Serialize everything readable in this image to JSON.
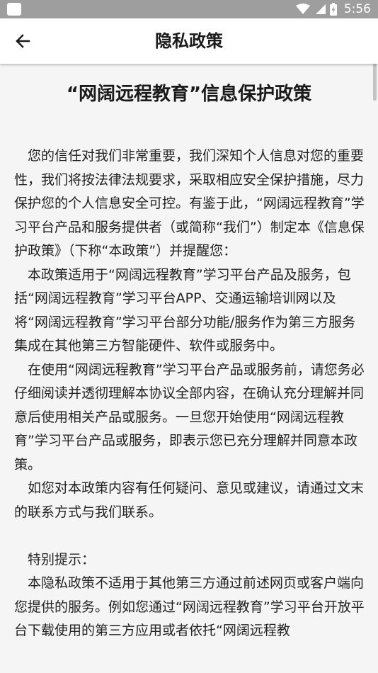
{
  "status_bar": {
    "time": "5:56"
  },
  "app_bar": {
    "title": "隐私政策"
  },
  "document": {
    "title": "“网阔远程教育”信息保护政策",
    "paragraphs": [
      "您的信任对我们非常重要，我们深知个人信息对您的重要性，我们将按法律法规要求，采取相应安全保护措施，尽力保护您的个人信息安全可控。有鉴于此，“网阔远程教育”学习平台产品和服务提供者（或简称“我们”）制定本《信息保护政策》（下称“本政策”）并提醒您：",
      "本政策适用于“网阔远程教育”学习平台产品及服务，包括“网阔远程教育”学习平台APP、交通运输培训网以及将“网阔远程教育”学习平台部分功能/服务作为第三方服务集成在其他第三方智能硬件、软件或服务中。",
      "在使用“网阔远程教育”学习平台产品或服务前，请您务必仔细阅读并透彻理解本协议全部内容，在确认充分理解并同意后使用相关产品或服务。一旦您开始使用“网阔远程教育”学习平台产品或服务，即表示您已充分理解并同意本政策。",
      "如您对本政策内容有任何疑问、意见或建议，请通过文末的联系方式与我们联系。",
      "特别提示：",
      "本隐私政策不适用于其他第三方通过前述网页或客户端向您提供的服务。例如您通过“网阔远程教育”学习平台开放平台下载使用的第三方应用或者依托“网阔远程教"
    ]
  }
}
